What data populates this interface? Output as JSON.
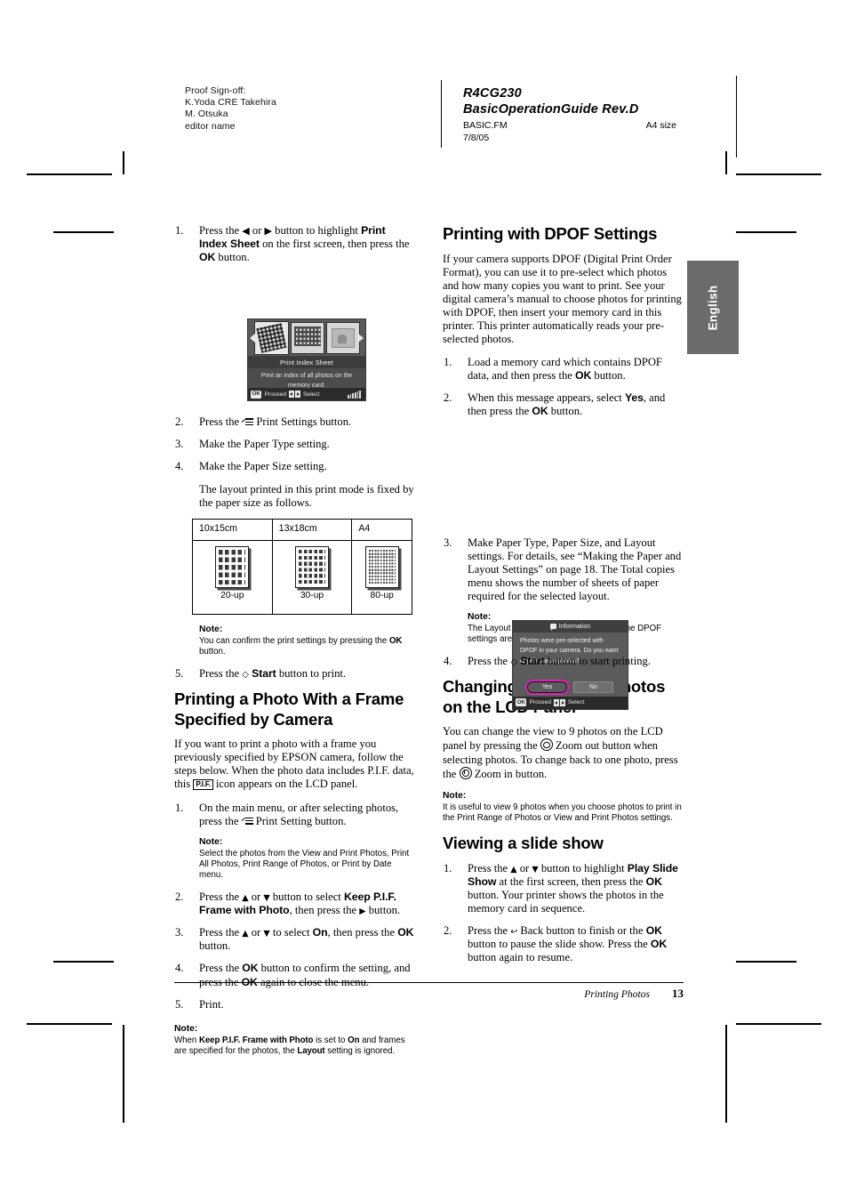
{
  "proof": {
    "signoff": [
      "Proof Sign-off:",
      "K.Yoda CRE Takehira",
      "M. Otsuka",
      "editor name"
    ],
    "doc_code": "R4CG230",
    "doc_title": "BasicOperationGuide Rev.D",
    "file_name": "BASIC.FM",
    "paper_size": "A4 size",
    "date": "7/8/05",
    "page_side": "R"
  },
  "lang_tab": "English",
  "left_column": {
    "step1": {
      "num": "1.",
      "text_a": "Press the ",
      "glyph_left": "◀",
      "text_b": " or ",
      "glyph_right": "▶",
      "text_c": " button to highlight ",
      "bold_a": "Print Index Sheet",
      "text_d": " on the first screen, then press the ",
      "bold_b": "OK",
      "text_e": " button."
    },
    "lcd_first_screen": {
      "title": "Print Index Sheet",
      "description": "Print an index of all photos on the memory card.",
      "status_ok": "OK",
      "status_proceed": "Proceed",
      "status_select": "Select"
    },
    "step2": {
      "num": "2.",
      "text_a": "Press the ",
      "text_b": " Print Settings button."
    },
    "step3": {
      "num": "3.",
      "text": "Make the Paper Type setting."
    },
    "step4": {
      "num": "4.",
      "text": "Make the Paper Size setting."
    },
    "step4_cont": "The layout printed in this print mode is fixed by the paper size as follows.",
    "layout_table": {
      "headers": [
        "10x15cm",
        "13x18cm",
        "A4"
      ],
      "captions": [
        "20-up",
        "30-up",
        "80-up"
      ]
    },
    "note1": {
      "label": "Note:",
      "text_a": "You can confirm the print settings by pressing the ",
      "bold": "OK",
      "text_b": " button."
    },
    "step5": {
      "num": "5.",
      "text_a": "Press the ",
      "glyph": "◇",
      "bold": "Start",
      "text_b": " button to print."
    },
    "heading_frame": "Printing a Photo With a Frame Specified by Camera",
    "frame_intro_a": "If you want to print a photo with a frame you previously specified by EPSON camera, follow the steps below. When the photo data includes P.I.F. data, this ",
    "pif_icon_label": "P.I.F.",
    "frame_intro_b": " icon appears on the LCD panel.",
    "fstep1": {
      "num": "1.",
      "text_a": "On the main menu, or after selecting photos, press the ",
      "text_b": " Print Setting button."
    },
    "note2": {
      "label": "Note:",
      "text": "Select the photos from the View and Print Photos, Print All Photos, Print Range of Photos, or Print by Date menu."
    },
    "fstep2": {
      "num": "2.",
      "text_a": "Press the ",
      "glyph_up": "▲",
      "text_b": " or ",
      "glyph_down": "▼",
      "text_c": " button to select ",
      "bold": "Keep P.I.F. Frame with Photo",
      "text_d": ", then press the ",
      "glyph_right": "▶",
      "text_e": " button."
    },
    "fstep3": {
      "num": "3.",
      "text_a": "Press the ",
      "glyph_up": "▲",
      "text_b": " or ",
      "glyph_down": "▼",
      "text_c": " to select ",
      "bold_a": "On",
      "text_d": ", then press the ",
      "bold_b": "OK",
      "text_e": " button."
    },
    "fstep4": {
      "num": "4.",
      "text_a": "Press the ",
      "bold_a": "OK",
      "text_b": " button to confirm the setting, and press the ",
      "bold_b": "OK",
      "text_c": " again to close the menu."
    },
    "fstep5": {
      "num": "5.",
      "text": "Print."
    },
    "note3": {
      "label": "Note:",
      "text_a": "When ",
      "bold_a": "Keep P.I.F. Frame with Photo",
      "text_b": " is set to ",
      "bold_b": "On",
      "text_c": " and frames are specified for the photos, the ",
      "bold_c": "Layout",
      "text_d": " setting is ignored."
    }
  },
  "right_column": {
    "heading_dpof": "Printing with DPOF Settings",
    "dpof_intro": "If your camera supports DPOF (Digital Print Order Format), you can use it to pre-select which photos and how many copies you want to print. See your digital camera’s manual to choose photos for printing with DPOF, then insert your memory card in this printer. This printer automatically reads your pre-selected photos.",
    "dstep1": {
      "num": "1.",
      "text_a": "Load a memory card which contains DPOF data, and then press the ",
      "bold": "OK",
      "text_b": " button."
    },
    "dstep2": {
      "num": "2.",
      "text_a": "When this message appears, select ",
      "bold_a": "Yes",
      "text_b": ", and then press the ",
      "bold_b": "OK",
      "text_c": " button."
    },
    "lcd_info_dialog": {
      "title": "Information",
      "message": "Photos were pre-selected with DPOF in your camera. Do you want to print these photos?",
      "button_yes": "Yes",
      "button_no": "No",
      "status_ok": "OK",
      "status_proceed": "Proceed",
      "status_select": "Select",
      "highlight_color": "#e020b0"
    },
    "dstep3": {
      "num": "3.",
      "text": "Make Paper Type, Paper Size, and Layout settings. For details, see “Making the Paper and Layout Settings” on page 18. The Total copies menu shows the number of sheets of paper required for the selected layout."
    },
    "note4": {
      "label": "Note:",
      "text": "The Layout setting is not available when the DPOF settings are for an Index print."
    },
    "dstep4": {
      "num": "4.",
      "text_a": "Press the ",
      "glyph": "◇",
      "bold": "Start",
      "text_b": " button to start printing."
    },
    "heading_view": "Changing the View of Photos on the LCD Panel",
    "view_intro_a": "You can change the view to 9 photos on the LCD panel by pressing the ",
    "view_intro_b": " Zoom out button when selecting photos. To change back to one photo, press the ",
    "view_intro_c": " Zoom in button.",
    "note5": {
      "label": "Note:",
      "text": "It is useful to view 9 photos when you choose photos to print in the Print Range of Photos or View and Print Photos settings."
    },
    "heading_slide": "Viewing a slide show",
    "sstep1": {
      "num": "1.",
      "text_a": "Press the ",
      "glyph_up": "▲",
      "text_b": " or ",
      "glyph_down": "▼",
      "text_c": " button to highlight ",
      "bold_a": "Play Slide Show",
      "text_d": " at the first screen, then press the ",
      "bold_b": "OK",
      "text_e": " button. Your printer shows the photos in the memory card in sequence."
    },
    "sstep2": {
      "num": "2.",
      "text_a": "Press the ",
      "glyph_back": "↩",
      "text_b": " Back button to finish or the ",
      "bold_a": "OK",
      "text_c": " button to pause the slide show. Press the ",
      "bold_b": "OK",
      "text_d": " button again to resume."
    }
  },
  "footer": {
    "section": "Printing Photos",
    "page_number": "13"
  }
}
